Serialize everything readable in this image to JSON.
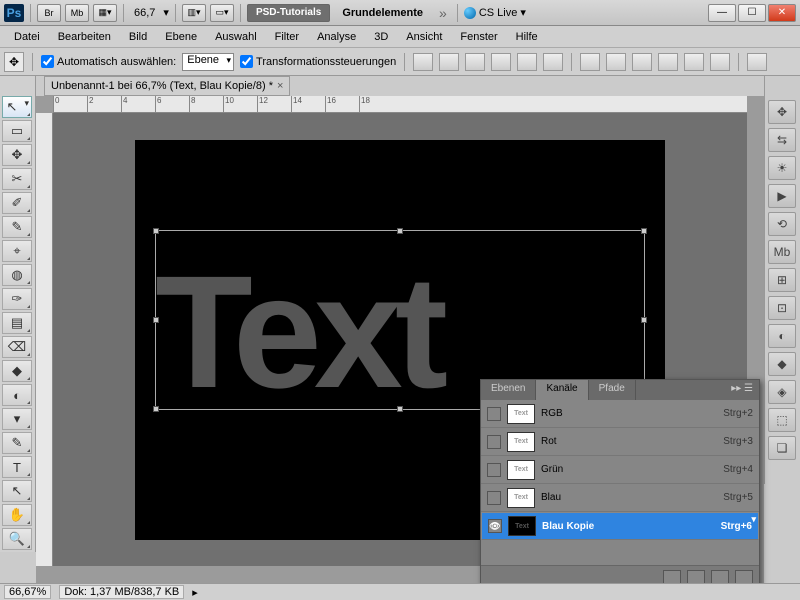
{
  "titlebar": {
    "app": "Ps",
    "br": "Br",
    "mb": "Mb",
    "zoom": "66,7",
    "workspace1": "PSD-Tutorials",
    "workspace2": "Grundelemente",
    "cslive": "CS Live"
  },
  "menu": [
    "Datei",
    "Bearbeiten",
    "Bild",
    "Ebene",
    "Auswahl",
    "Filter",
    "Analyse",
    "3D",
    "Ansicht",
    "Fenster",
    "Hilfe"
  ],
  "options": {
    "auto_select": "Automatisch auswählen:",
    "auto_select_value": "Ebene",
    "transform_controls": "Transformationssteuerungen"
  },
  "doc_tab": "Unbenannt-1 bei 66,7% (Text, Blau Kopie/8) *",
  "canvas_text": "Text",
  "ruler_marks": [
    "0",
    "2",
    "4",
    "6",
    "8",
    "10",
    "12",
    "14",
    "16",
    "18"
  ],
  "channels_panel": {
    "tabs": [
      "Ebenen",
      "Kanäle",
      "Pfade"
    ],
    "active_tab": 1,
    "rows": [
      {
        "name": "RGB",
        "key": "Strg+2",
        "visible": false,
        "dark": false,
        "selected": false
      },
      {
        "name": "Rot",
        "key": "Strg+3",
        "visible": false,
        "dark": false,
        "selected": false
      },
      {
        "name": "Grün",
        "key": "Strg+4",
        "visible": false,
        "dark": false,
        "selected": false
      },
      {
        "name": "Blau",
        "key": "Strg+5",
        "visible": false,
        "dark": false,
        "selected": false
      },
      {
        "name": "Blau Kopie",
        "key": "Strg+6",
        "visible": true,
        "dark": true,
        "selected": true
      }
    ]
  },
  "status": {
    "zoom": "66,67%",
    "docinfo": "Dok: 1,37 MB/838,7 KB"
  },
  "tools": [
    "↖",
    "▭",
    "✥",
    "✂",
    "✐",
    "✎",
    "⌖",
    "◍",
    "✑",
    "▤",
    "⌫",
    "◆",
    "◐",
    "▾",
    "✎",
    "T",
    "↖",
    "✋",
    "🔍"
  ],
  "right_tools": [
    "✥",
    "⇆",
    "☀",
    "▶",
    "⟲",
    "Mb",
    "⊞",
    "⊡",
    "◐",
    "◆",
    "◈",
    "⬚",
    "❏"
  ]
}
